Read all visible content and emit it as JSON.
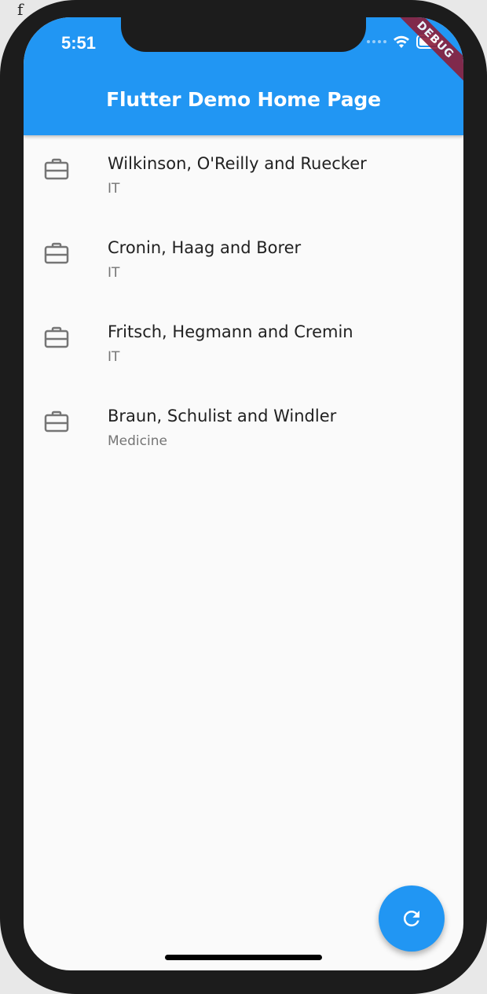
{
  "status_bar": {
    "time": "5:51",
    "icons": [
      "signal-dots-icon",
      "wifi-icon",
      "battery-icon"
    ]
  },
  "app_bar": {
    "title": "Flutter Demo Home Page",
    "color": "#2196f3"
  },
  "debug_banner": {
    "label": "DEBUG",
    "color": "#8b1e3a"
  },
  "companies": [
    {
      "name": "Wilkinson, O'Reilly and Ruecker",
      "category": "IT",
      "icon": "briefcase-icon"
    },
    {
      "name": "Cronin, Haag and Borer",
      "category": "IT",
      "icon": "briefcase-icon"
    },
    {
      "name": "Fritsch, Hegmann and Cremin",
      "category": "IT",
      "icon": "briefcase-icon"
    },
    {
      "name": "Braun, Schulist and Windler",
      "category": "Medicine",
      "icon": "briefcase-icon"
    }
  ],
  "fab": {
    "icon": "refresh-icon",
    "color": "#2196f3"
  }
}
